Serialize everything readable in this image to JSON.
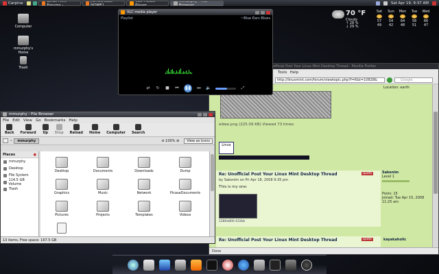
{
  "top_panel": {
    "user": "Carpina",
    "tasks": [
      "Linux Mint Forums -",
      "[SHOUTcast - HOME]",
      "VLC Media Player",
      "mmurphy - File Browser"
    ],
    "clock": "Sat Apr 19, 9:37 AM"
  },
  "desktop": {
    "icons": [
      "Computer",
      "mmurphy's Home",
      "Trash"
    ]
  },
  "weather": {
    "temp": "70 °F",
    "condition": "Cloudy",
    "details": [
      "↑ 28 %",
      "↓ 29 %"
    ],
    "days": [
      {
        "name": "Sat",
        "temps": "57 49"
      },
      {
        "name": "Sun",
        "temps": "54 42"
      },
      {
        "name": "Mon",
        "temps": "64 48"
      },
      {
        "name": "Tue",
        "temps": "58 51"
      },
      {
        "name": "Wed",
        "temps": "66 47"
      }
    ]
  },
  "vlc": {
    "title": "VLC media player",
    "playlist": "Playlist",
    "song": "~Blue Ears Blues",
    "volume": 0.55
  },
  "firefox": {
    "title": "Linux Mint Forums :: View topic - Unofficial Post Your Linux Mint Desktop Thread - Mozilla Firefox",
    "menu": [
      "Tools",
      "Help"
    ],
    "url": "http://linuxmint.com/forum/viewtopic.php?f=6&t=10828&",
    "search_placeholder": "Google",
    "location_label": "Location: earth",
    "attachment": "eldee.png (225.09 KB) Viewed 73 times",
    "post1": {
      "title": "Re: Unofficial Post Your Linux Mint Desktop Thread",
      "by": "by Sakonim on Fri Apr 18, 2008 9:35 pm",
      "body": "This is my one:",
      "thumb_caption": "1280x800 433kb",
      "author": "Sakonim",
      "level": "Level 1",
      "posts": "Posts: 15",
      "joined": "Joined: Tue Apr 15, 2008 11:25 am"
    },
    "post2": {
      "title": "Re: Unofficial Post Your Linux Mint Desktop Thread",
      "author": "kayakaholic"
    },
    "quote_label": "quote",
    "status": "Done"
  },
  "nautilus": {
    "title": "mmurphy - File Browser",
    "menu": [
      "File",
      "Edit",
      "View",
      "Go",
      "Bookmarks",
      "Help"
    ],
    "toolbar": [
      "Back",
      "Forward",
      "Up",
      "Stop",
      "Reload",
      "Home",
      "Computer",
      "Search"
    ],
    "breadcrumb": "mmurphy",
    "zoom": "100%",
    "view_as": "View as Icons",
    "places_label": "Places",
    "places": [
      "mmurphy",
      "Desktop",
      "File System",
      "114.5 GB Volume",
      "Trash"
    ],
    "files": [
      "Desktop",
      "Documents",
      "Downloads",
      "Dump",
      "Graphics",
      "Music",
      "Network",
      "PicasaDocuments",
      "Pictures",
      "Projects",
      "Templates",
      "Videos"
    ],
    "status": "13 items, Free space: 167.5 GB"
  },
  "dock_icons": [
    "mint-logo-icon",
    "files-icon",
    "itunes-icon",
    "film-icon",
    "vlc-icon",
    "terminal-icon",
    "cd-icon",
    "firefox-icon",
    "trash-icon",
    "screen-icon",
    "window-icon",
    "power-icon"
  ]
}
